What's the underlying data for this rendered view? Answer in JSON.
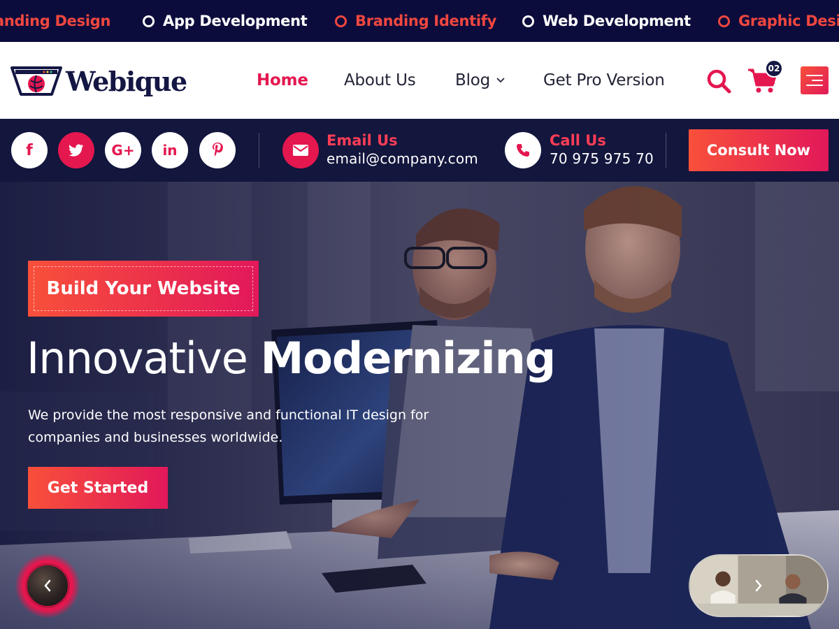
{
  "ticker": {
    "items": [
      {
        "label": "anding Design",
        "color": "red"
      },
      {
        "label": "App Development",
        "color": "white"
      },
      {
        "label": "Branding Identify",
        "color": "red"
      },
      {
        "label": "Web Development",
        "color": "white"
      },
      {
        "label": "Graphic Desig",
        "color": "red"
      }
    ]
  },
  "brand": {
    "name": "Webique",
    "accent": "#e4174f",
    "navy": "#141643"
  },
  "nav": {
    "home": "Home",
    "about": "About Us",
    "blog": "Blog",
    "pro": "Get Pro Version"
  },
  "header_actions": {
    "cart_count": "02",
    "search_icon": "search-icon",
    "cart_icon": "cart-icon",
    "menu_icon": "hamburger-icon"
  },
  "social": [
    {
      "name": "facebook",
      "glyph": "f"
    },
    {
      "name": "twitter",
      "glyph": "t"
    },
    {
      "name": "google-plus",
      "glyph": "G+"
    },
    {
      "name": "linkedin",
      "glyph": "in"
    },
    {
      "name": "pinterest",
      "glyph": "p"
    }
  ],
  "contact": {
    "email_title": "Email Us",
    "email_value": "email@company.com",
    "call_title": "Call Us",
    "call_value": "70 975 975 70",
    "consult_label": "Consult Now"
  },
  "hero": {
    "tagline": "Build Your Website",
    "title_light": "Innovative",
    "title_bold": "Modernizing",
    "description": "We provide the most responsive and functional IT design for companies and businesses worldwide.",
    "cta_label": "Get Started"
  }
}
